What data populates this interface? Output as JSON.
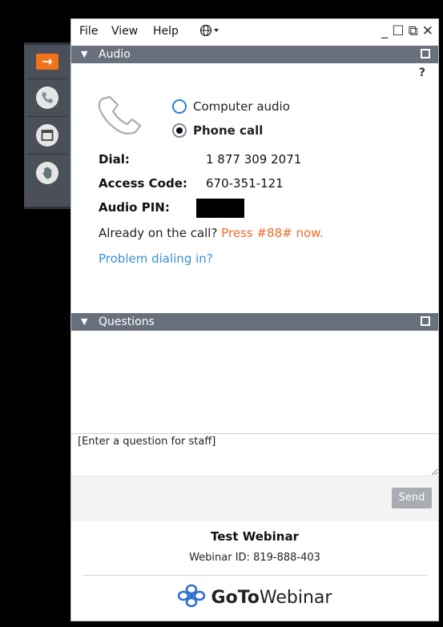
{
  "menu": {
    "file": "File",
    "view": "View",
    "help": "Help",
    "globe_icon": "globe-icon"
  },
  "window_controls": {
    "minimize": "_",
    "maximize": "☐",
    "popout": "⧉",
    "close": "✕"
  },
  "audio_panel": {
    "title": "Audio",
    "help": "?",
    "options": {
      "computer_audio": "Computer audio",
      "phone_call": "Phone call"
    },
    "selected": "phone_call",
    "dial_label": "Dial:",
    "dial_value": "1 877 309 2071",
    "access_label": "Access Code:",
    "access_value": "670-351-121",
    "pin_label": "Audio PIN:",
    "already_text": "Already on the call?",
    "press_text": "Press #88# now.",
    "problem_link": "Problem dialing in?"
  },
  "questions_panel": {
    "title": "Questions",
    "input_value": "[Enter a question for staff]",
    "send_label": "Send"
  },
  "footer": {
    "webinar_title": "Test Webinar",
    "webinar_id": "Webinar ID: 819-888-403",
    "brand_goto": "GoTo",
    "brand_webinar": "Webinar"
  },
  "colors": {
    "accent_orange": "#f0731c",
    "panel_header": "#68707d",
    "link_blue": "#3a8fd9"
  }
}
